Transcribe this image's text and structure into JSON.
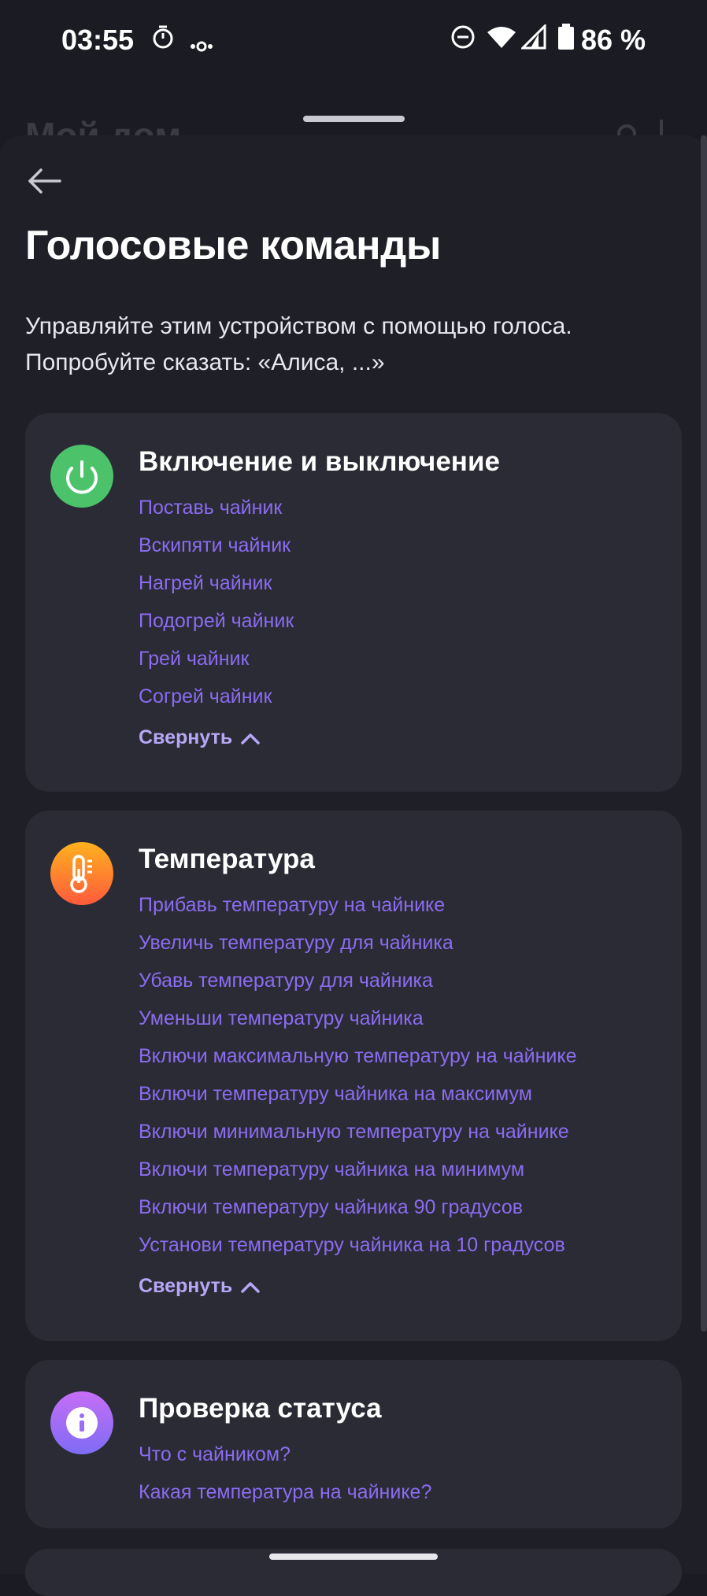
{
  "status_bar": {
    "time": "03:55",
    "battery": "86 %"
  },
  "background": {
    "title": "Мой дом"
  },
  "page": {
    "title": "Голосовые команды",
    "subtitle": "Управляйте этим устройством с помощью голоса. Попробуйте сказать: «Алиса, ...»"
  },
  "sections": [
    {
      "title": "Включение и выключение",
      "icon": "power-icon",
      "color": "#4cc36b",
      "commands": [
        "Поставь чайник",
        "Вскипяти чайник",
        "Нагрей чайник",
        "Подогрей чайник",
        "Грей чайник",
        "Согрей чайник"
      ],
      "collapse_label": "Свернуть"
    },
    {
      "title": "Температура",
      "icon": "thermometer-icon",
      "color": "#ff7a2e",
      "commands": [
        "Прибавь температуру на чайнике",
        "Увеличь температуру для чайника",
        "Убавь температуру для чайника",
        "Уменьши температуру чайника",
        "Включи максимальную температуру на чайнике",
        "Включи температуру чайника на максимум",
        "Включи минимальную температуру на чайнике",
        "Включи температуру чайника на минимум",
        "Включи температуру чайника 90 градусов",
        "Установи температуру чайника на 10 градусов"
      ],
      "collapse_label": "Свернуть"
    },
    {
      "title": "Проверка статуса",
      "icon": "info-icon",
      "color": "#9c6cf5",
      "commands": [
        "Что с чайником?",
        "Какая температура на чайнике?"
      ]
    }
  ]
}
